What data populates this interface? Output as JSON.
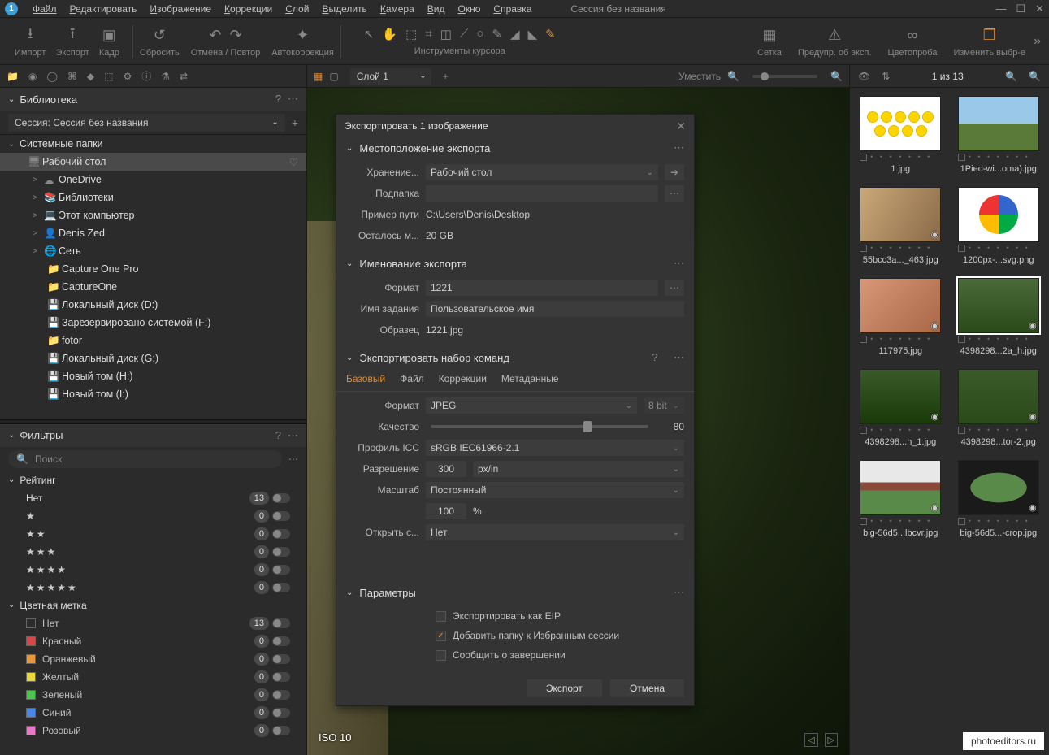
{
  "menu": {
    "items": [
      "Файл",
      "Редактировать",
      "Изображение",
      "Коррекции",
      "Слой",
      "Выделить",
      "Камера",
      "Вид",
      "Окно",
      "Справка"
    ],
    "session": "Сессия без названия"
  },
  "toolbar": {
    "import": "Импорт",
    "export": "Экспорт",
    "frame": "Кадр",
    "reset": "Сбросить",
    "undo_redo": "Отмена / Повтор",
    "autocorrect": "Автокоррекция",
    "cursor_tools": "Инструменты курсора",
    "grid": "Сетка",
    "exposure_warn": "Предупр. об эксп.",
    "colorproof": "Цветопроба",
    "change_sel": "Изменить выбр-е"
  },
  "left": {
    "library": "Библиотека",
    "session_label": "Сессия: Сессия без названия",
    "sys_folders": "Системные папки",
    "tree": [
      {
        "txt": "Рабочий стол",
        "icon": "desktop",
        "lvl": 1,
        "selected": true,
        "heart": true
      },
      {
        "txt": "OneDrive",
        "icon": "cloud",
        "lvl": 2,
        "chev": ">"
      },
      {
        "txt": "Библиотеки",
        "icon": "lib",
        "lvl": 2,
        "chev": ">"
      },
      {
        "txt": "Этот компьютер",
        "icon": "pc",
        "lvl": 2,
        "chev": ">"
      },
      {
        "txt": "Denis Zed",
        "icon": "user",
        "lvl": 2,
        "chev": ">"
      },
      {
        "txt": "Сеть",
        "icon": "net",
        "lvl": 2,
        "chev": ">"
      },
      {
        "txt": "Capture One Pro",
        "icon": "folder",
        "lvl": 3
      },
      {
        "txt": "CaptureOne",
        "icon": "folder",
        "lvl": 3
      },
      {
        "txt": "Локальный диск (D:)",
        "icon": "disk",
        "lvl": 3
      },
      {
        "txt": "Зарезервировано системой (F:)",
        "icon": "disk",
        "lvl": 3
      },
      {
        "txt": "fotor",
        "icon": "folder",
        "lvl": 3
      },
      {
        "txt": "Локальный диск (G:)",
        "icon": "disk",
        "lvl": 3
      },
      {
        "txt": "Новый том (H:)",
        "icon": "disk",
        "lvl": 3
      },
      {
        "txt": "Новый том (I:)",
        "icon": "disk",
        "lvl": 3
      }
    ],
    "filters": "Фильтры",
    "search_ph": "Поиск",
    "rating": "Рейтинг",
    "rating_rows": [
      {
        "label": "Нет",
        "count": "13"
      },
      {
        "label": "★",
        "count": "0"
      },
      {
        "label": "★★",
        "count": "0"
      },
      {
        "label": "★★★",
        "count": "0"
      },
      {
        "label": "★★★★",
        "count": "0"
      },
      {
        "label": "★★★★★",
        "count": "0"
      }
    ],
    "colorlabel": "Цветная метка",
    "colors": [
      {
        "label": "Нет",
        "color": "transparent",
        "count": "13"
      },
      {
        "label": "Красный",
        "color": "#d84848",
        "count": "0"
      },
      {
        "label": "Оранжевый",
        "color": "#e8983a",
        "count": "0"
      },
      {
        "label": "Желтый",
        "color": "#e8d83a",
        "count": "0"
      },
      {
        "label": "Зеленый",
        "color": "#4ac84a",
        "count": "0"
      },
      {
        "label": "Синий",
        "color": "#4888e8",
        "count": "0"
      },
      {
        "label": "Розовый",
        "color": "#e878c8",
        "count": "0"
      }
    ]
  },
  "center": {
    "layer": "Слой 1",
    "fit": "Уместить",
    "iso": "ISO 10"
  },
  "dialog": {
    "title": "Экспортировать 1 изображение",
    "loc_head": "Местоположение экспорта",
    "storage_lbl": "Хранение...",
    "storage_val": "Рабочий стол",
    "subfolder_lbl": "Подпапка",
    "path_lbl": "Пример пути",
    "path_val": "C:\\Users\\Denis\\Desktop",
    "remain_lbl": "Осталось м...",
    "remain_val": "20 GB",
    "naming_head": "Именование экспорта",
    "format_lbl": "Формат",
    "format_val": "1221",
    "jobname_lbl": "Имя задания",
    "jobname_val": "Пользовательское имя",
    "sample_lbl": "Образец",
    "sample_val": "1221.jpg",
    "recipe_head": "Экспортировать набор команд",
    "tabs": {
      "basic": "Базовый",
      "file": "Файл",
      "corr": "Коррекции",
      "meta": "Метаданные"
    },
    "fmt_lbl": "Формат",
    "fmt_val": "JPEG",
    "bit_val": "8 bit",
    "quality_lbl": "Качество",
    "quality_val": "80",
    "icc_lbl": "Профиль ICC",
    "icc_val": "sRGB IEC61966-2.1",
    "res_lbl": "Разрешение",
    "res_val": "300",
    "res_unit": "px/in",
    "scale_lbl": "Масштаб",
    "scale_val": "Постоянный",
    "scale_pct": "100",
    "pct": "%",
    "open_lbl": "Открыть с...",
    "open_val": "Нет",
    "params_head": "Параметры",
    "eip": "Экспортировать как EIP",
    "favfolder": "Добавить папку к Избранным сессии",
    "notify": "Сообщить о завершении",
    "export_btn": "Экспорт",
    "cancel_btn": "Отмена"
  },
  "right": {
    "counter": "1 из 13",
    "thumbs": [
      {
        "name": "1.jpg",
        "cls": "th1"
      },
      {
        "name": "1Pied-wi...oma).jpg",
        "cls": "th2"
      },
      {
        "name": "55bcc3a..._463.jpg",
        "cls": "th3",
        "corner": true
      },
      {
        "name": "1200px-...svg.png",
        "cls": "th4"
      },
      {
        "name": "117975.jpg",
        "cls": "th5",
        "corner": true
      },
      {
        "name": "4398298...2a_h.jpg",
        "cls": "th6",
        "selected": true,
        "corner": true
      },
      {
        "name": "4398298...h_1.jpg",
        "cls": "th7",
        "corner": true
      },
      {
        "name": "4398298...tor-2.jpg",
        "cls": "th8",
        "corner": true
      },
      {
        "name": "big-56d5...lbcvr.jpg",
        "cls": "th9",
        "corner": true
      },
      {
        "name": "big-56d5...-crop.jpg",
        "cls": "th10",
        "corner": true
      }
    ]
  },
  "watermark": "photoeditors.ru"
}
